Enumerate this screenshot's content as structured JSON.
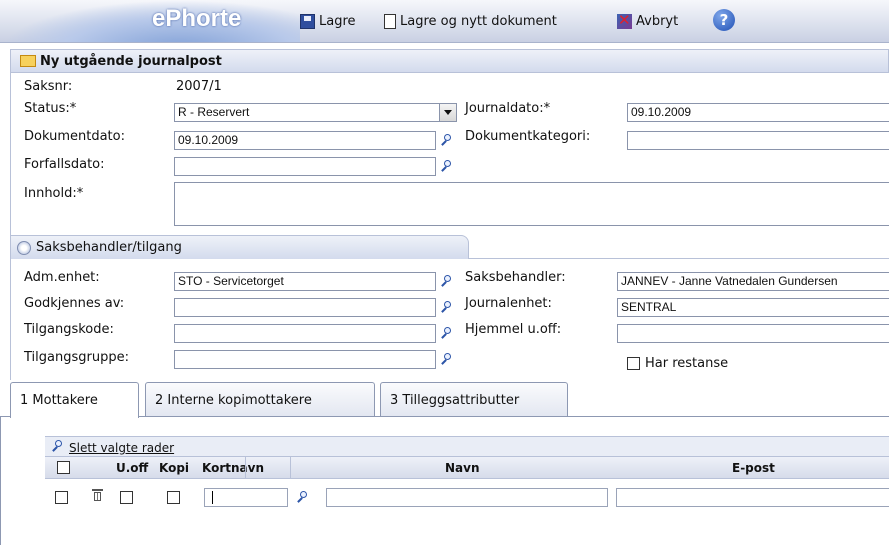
{
  "toolbar": {
    "brand": "ePhorte",
    "save_label": "Lagre",
    "save_new_label": "Lagre og nytt dokument",
    "cancel_label": "Avbryt",
    "help_label": "?"
  },
  "journalpost": {
    "header": "Ny utgående journalpost",
    "saksnr_label": "Saksnr:",
    "saksnr_value": "2007/1",
    "status_label": "Status:*",
    "status_value": "R - Reservert",
    "journaldato_label": "Journaldato:*",
    "journaldato_value": "09.10.2009",
    "dokumentdato_label": "Dokumentdato:",
    "dokumentdato_value": "09.10.2009",
    "dokumentkategori_label": "Dokumentkategori:",
    "dokumentkategori_value": "",
    "forfallsdato_label": "Forfallsdato:",
    "forfallsdato_value": "",
    "innhold_label": "Innhold:*",
    "innhold_value": ""
  },
  "saksbehandler": {
    "tab_label": "Saksbehandler/tilgang",
    "adm_enhet_label": "Adm.enhet:",
    "adm_enhet_value": "STO - Servicetorget",
    "saksbehandler_label": "Saksbehandler:",
    "saksbehandler_value": "JANNEV - Janne Vatnedalen Gundersen",
    "godkjennes_label": "Godkjennes av:",
    "godkjennes_value": "",
    "journalenhet_label": "Journalenhet:",
    "journalenhet_value": "SENTRAL",
    "tilgangskode_label": "Tilgangskode:",
    "tilgangskode_value": "",
    "hjemmel_label": "Hjemmel u.off:",
    "hjemmel_value": "",
    "tilgangsgruppe_label": "Tilgangsgruppe:",
    "tilgangsgruppe_value": "",
    "restanse_label": "Har restanse",
    "restanse_checked": false
  },
  "tabs": [
    {
      "label": "1 Mottakere"
    },
    {
      "label": "2 Interne kopimottakere"
    },
    {
      "label": "3 Tilleggsattributter"
    }
  ],
  "grid": {
    "delete_rows_label": "Slett valgte rader",
    "columns": {
      "uoff": "U.off",
      "kopi": "Kopi",
      "kortnavn": "Kortnavn",
      "navn": "Navn",
      "epost": "E-post"
    }
  }
}
